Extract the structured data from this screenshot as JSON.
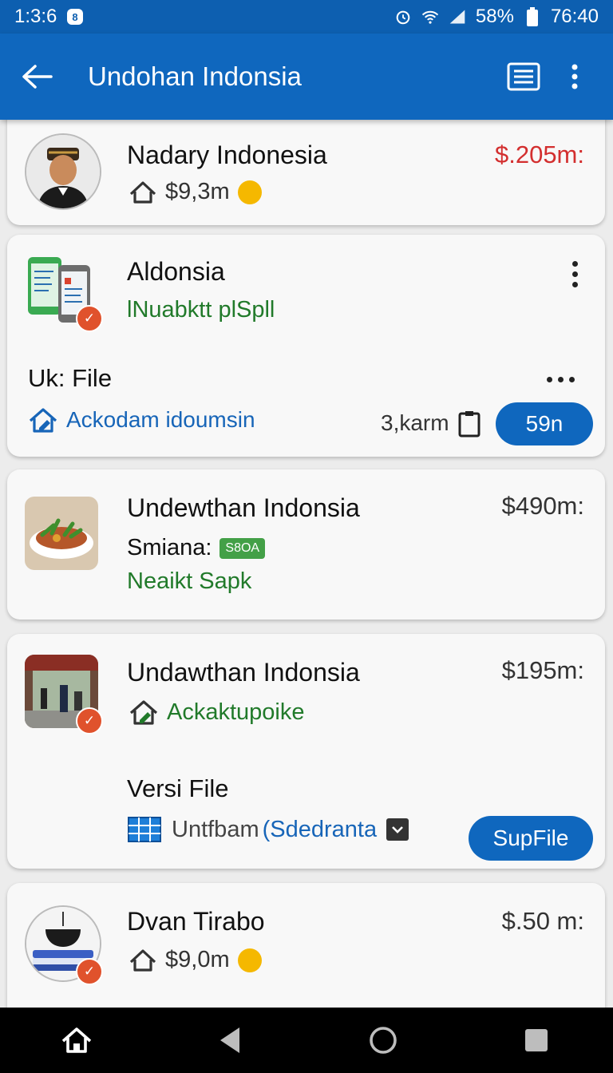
{
  "status": {
    "time": "1:3:6",
    "battery": "58%",
    "clock": "76:40"
  },
  "appbar": {
    "title": "Undohan Indonsia"
  },
  "cards": [
    {
      "name": "Nadary Indonesia",
      "price": "$.205m:",
      "sub_price": "$9,3m"
    },
    {
      "name": "Aldonsia",
      "subtitle": "lNuabktt plSpll",
      "file_label": "Uk: File",
      "link": "Ackodam idoumsin",
      "count": "3,karm",
      "button": "59n"
    },
    {
      "name": "Undewthan Indonsia",
      "price": "$490m:",
      "line1": "Smiana:",
      "badge": "S8OA",
      "line2": "Neaikt Sapk"
    },
    {
      "name": "Undawthan Indonsia",
      "price": "$195m:",
      "link": "Ackaktupoike",
      "file_label": "Versi File",
      "select_a": "Untfbam",
      "select_b": "(Sdedranta",
      "button": "SupFile"
    },
    {
      "name": "Dvan Tirabo",
      "price": "$.50 m:",
      "sub_price": "$9,0m"
    }
  ],
  "colors": {
    "appbar": "#0f67be",
    "status": "#0d5fb0",
    "price_red": "#d32f2f",
    "green": "#217a2a",
    "link_blue": "#1765b8"
  }
}
